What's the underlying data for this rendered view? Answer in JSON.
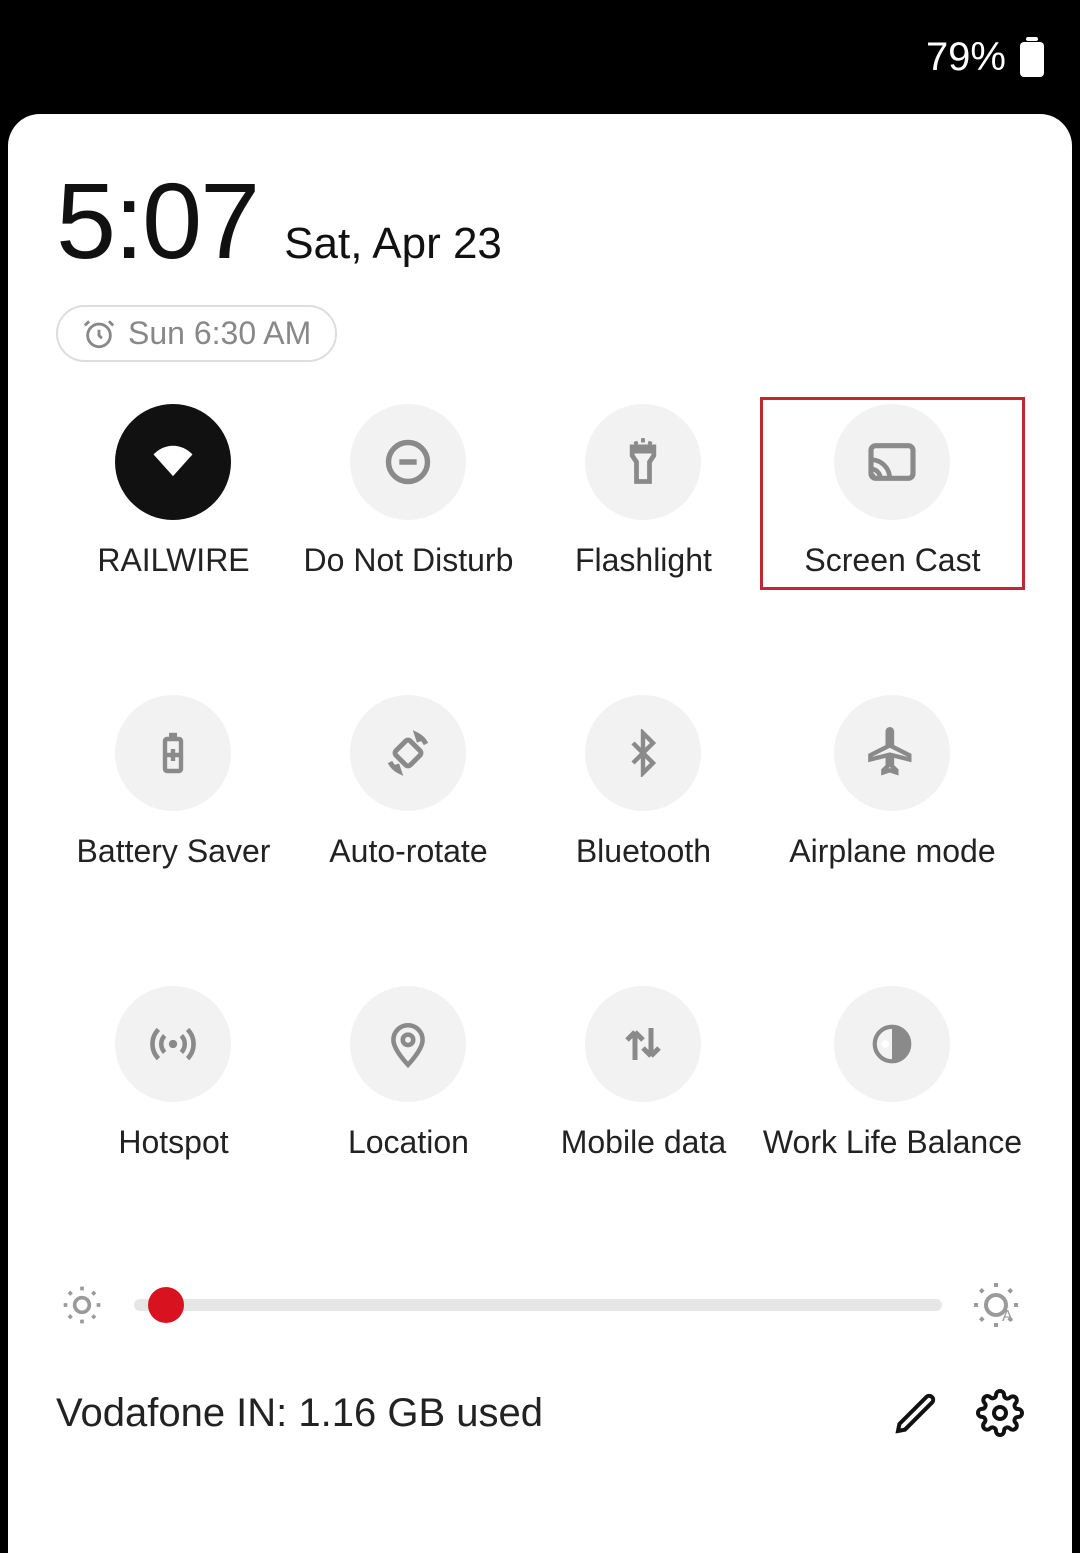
{
  "statusbar": {
    "battery_pct": "79%"
  },
  "header": {
    "time": "5:07",
    "date": "Sat, Apr 23",
    "alarm": "Sun 6:30 AM"
  },
  "tiles": [
    {
      "id": "wifi",
      "label": "RAILWIRE",
      "active": true,
      "highlight": false
    },
    {
      "id": "dnd",
      "label": "Do Not Disturb",
      "active": false,
      "highlight": false
    },
    {
      "id": "flashlight",
      "label": "Flashlight",
      "active": false,
      "highlight": false
    },
    {
      "id": "screencast",
      "label": "Screen Cast",
      "active": false,
      "highlight": true
    },
    {
      "id": "batterysaver",
      "label": "Battery Saver",
      "active": false,
      "highlight": false
    },
    {
      "id": "autorotate",
      "label": "Auto-rotate",
      "active": false,
      "highlight": false
    },
    {
      "id": "bluetooth",
      "label": "Bluetooth",
      "active": false,
      "highlight": false
    },
    {
      "id": "airplane",
      "label": "Airplane mode",
      "active": false,
      "highlight": false
    },
    {
      "id": "hotspot",
      "label": "Hotspot",
      "active": false,
      "highlight": false
    },
    {
      "id": "location",
      "label": "Location",
      "active": false,
      "highlight": false
    },
    {
      "id": "mobiledata",
      "label": "Mobile data",
      "active": false,
      "highlight": false
    },
    {
      "id": "worklife",
      "label": "Work Life Balance",
      "active": false,
      "highlight": false
    }
  ],
  "brightness": {
    "value_pct": 4
  },
  "footer": {
    "carrier_text": "Vodafone IN: 1.16 GB used"
  },
  "colors": {
    "accent": "#d8121e",
    "highlight_box": "#c1272d"
  }
}
